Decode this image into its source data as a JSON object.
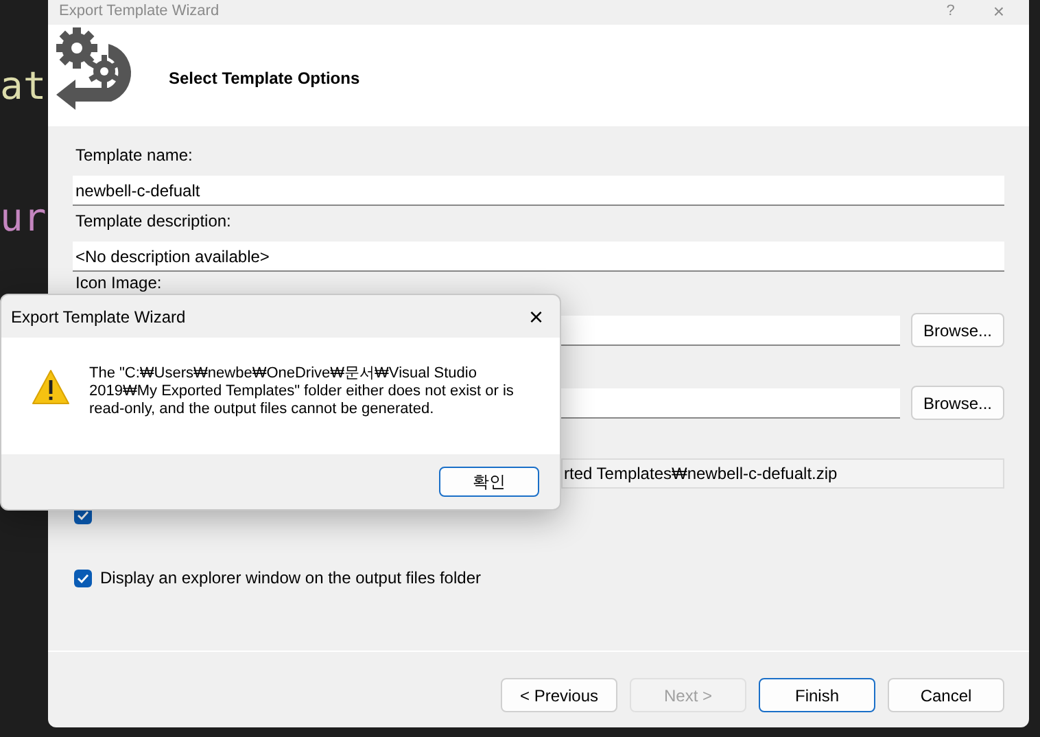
{
  "background_code": [
    "at",
    "ur"
  ],
  "window": {
    "title": "Export Template Wizard",
    "help": "?",
    "close": "×"
  },
  "header": {
    "title": "Select Template Options"
  },
  "fields": [
    {
      "label": "Template name:",
      "value": "newbell-c-defualt"
    },
    {
      "label": "Template description:",
      "value": "<No description available>"
    },
    {
      "label": "Icon Image:",
      "button": "Browse..."
    },
    {
      "button": "Browse..."
    },
    {
      "value": "rted Templates₩newbell-c-defualt.zip",
      "readonly": true
    }
  ],
  "options": [
    {
      "checked": true
    },
    {
      "label": "Display an explorer window on the output files folder",
      "checked": true
    }
  ],
  "buttons": [
    {
      "label": "< Previous",
      "disabled": false,
      "default": false
    },
    {
      "label": "Next >",
      "disabled": true,
      "default": false
    },
    {
      "label": "Finish",
      "disabled": false,
      "default": true
    },
    {
      "label": "Cancel",
      "disabled": false,
      "default": false
    }
  ],
  "dialog": {
    "title": "Export Template Wizard",
    "close": "×",
    "message": "The \"C:₩Users₩newbe₩OneDrive₩문서₩Visual Studio 2019₩My Exported Templates\" folder either does not exist or is read-only, and the output files cannot be generated.",
    "button": "확인"
  }
}
